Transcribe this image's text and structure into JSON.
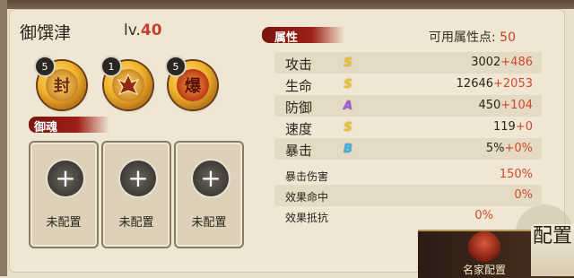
{
  "character": {
    "name": "御馔津",
    "lv_prefix": "lv.",
    "level": "40"
  },
  "skills": [
    {
      "count": "5",
      "glyph": "封",
      "icon": "seal-skill-icon"
    },
    {
      "count": "1",
      "glyph": "",
      "icon": "flame-skill-icon"
    },
    {
      "count": "5",
      "glyph": "爆",
      "icon": "burst-skill-icon"
    }
  ],
  "soul_section": {
    "title": "御魂"
  },
  "soul_slots": [
    {
      "label": "未配置"
    },
    {
      "label": "未配置"
    },
    {
      "label": "未配置"
    }
  ],
  "attributes": {
    "title": "属性",
    "points_label": "可用属性点:",
    "points_value": "50",
    "stats": [
      {
        "label": "攻击",
        "grade": "S",
        "base": "3002",
        "bonus": "+486"
      },
      {
        "label": "生命",
        "grade": "S",
        "base": "12646",
        "bonus": "+2053"
      },
      {
        "label": "防御",
        "grade": "A",
        "base": "450",
        "bonus": "+104"
      },
      {
        "label": "速度",
        "grade": "S",
        "base": "119",
        "bonus": "+0"
      },
      {
        "label": "暴击",
        "grade": "B",
        "base": "5%",
        "bonus": "+0%"
      }
    ],
    "extra": [
      {
        "label": "暴击伤害",
        "value": "150%"
      },
      {
        "label": "效果命中",
        "value": "0%"
      },
      {
        "label": "效果抵抗",
        "value": "0%"
      }
    ]
  },
  "preset": {
    "label": "名家配置",
    "seal_text": "配置"
  },
  "colors": {
    "grade_S": "#f2c42a",
    "grade_A": "#a05ad8",
    "grade_B": "#3cb0e6",
    "accent": "#c2402c"
  }
}
